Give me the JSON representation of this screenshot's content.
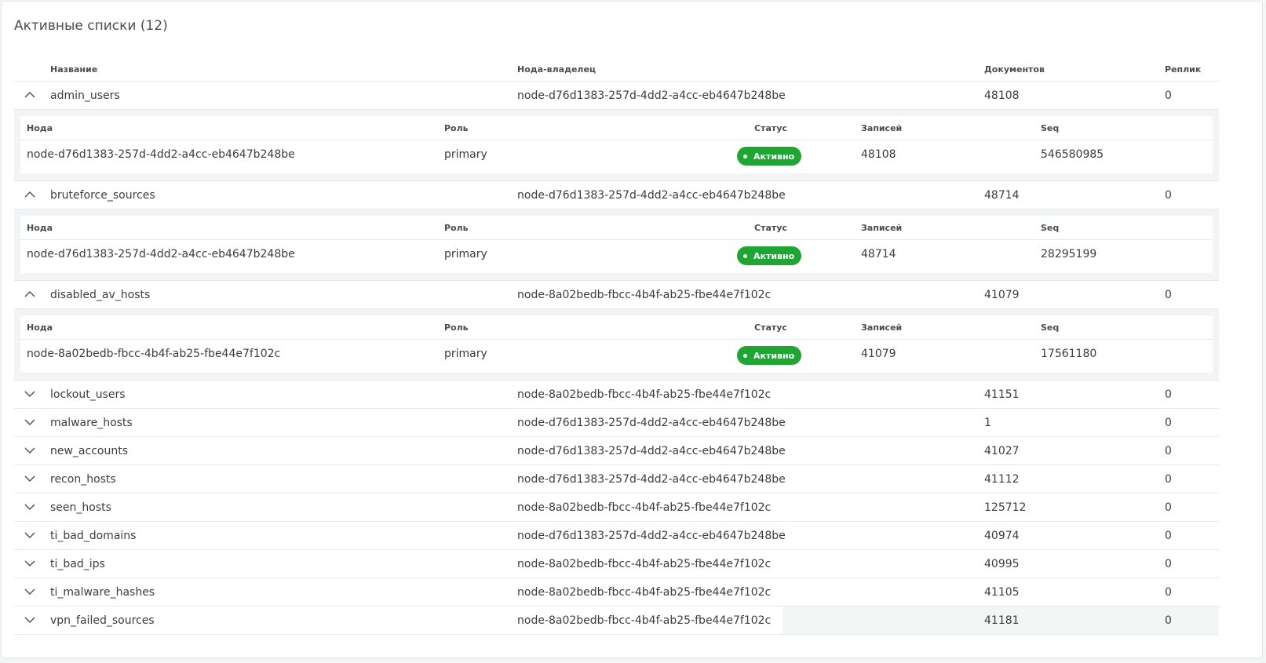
{
  "title": "Активные списки (12)",
  "columns": {
    "name": "Название",
    "owner": "Нода-владелец",
    "docs": "Документов",
    "replicas": "Реплик"
  },
  "sub_columns": {
    "node": "Нода",
    "role": "Роль",
    "status": "Статус",
    "records": "Записей",
    "seq": "Seq"
  },
  "colors": {
    "status_active": "#1ea532",
    "highlight": "#f2f6f4"
  },
  "rows": [
    {
      "name": "admin_users",
      "owner": "node-d76d1383-257d-4dd2-a4cc-eb4647b248be",
      "docs": "48108",
      "replicas": "0",
      "expanded": true,
      "detail": {
        "node": "node-d76d1383-257d-4dd2-a4cc-eb4647b248be",
        "role": "primary",
        "status": "Активно",
        "records": "48108",
        "seq": "546580985"
      }
    },
    {
      "name": "bruteforce_sources",
      "owner": "node-d76d1383-257d-4dd2-a4cc-eb4647b248be",
      "docs": "48714",
      "replicas": "0",
      "expanded": true,
      "detail": {
        "node": "node-d76d1383-257d-4dd2-a4cc-eb4647b248be",
        "role": "primary",
        "status": "Активно",
        "records": "48714",
        "seq": "28295199"
      }
    },
    {
      "name": "disabled_av_hosts",
      "owner": "node-8a02bedb-fbcc-4b4f-ab25-fbe44e7f102c",
      "docs": "41079",
      "replicas": "0",
      "expanded": true,
      "detail": {
        "node": "node-8a02bedb-fbcc-4b4f-ab25-fbe44e7f102c",
        "role": "primary",
        "status": "Активно",
        "records": "41079",
        "seq": "17561180"
      }
    },
    {
      "name": "lockout_users",
      "owner": "node-8a02bedb-fbcc-4b4f-ab25-fbe44e7f102c",
      "docs": "41151",
      "replicas": "0",
      "expanded": false
    },
    {
      "name": "malware_hosts",
      "owner": "node-d76d1383-257d-4dd2-a4cc-eb4647b248be",
      "docs": "1",
      "replicas": "0",
      "expanded": false
    },
    {
      "name": "new_accounts",
      "owner": "node-d76d1383-257d-4dd2-a4cc-eb4647b248be",
      "docs": "41027",
      "replicas": "0",
      "expanded": false
    },
    {
      "name": "recon_hosts",
      "owner": "node-d76d1383-257d-4dd2-a4cc-eb4647b248be",
      "docs": "41112",
      "replicas": "0",
      "expanded": false
    },
    {
      "name": "seen_hosts",
      "owner": "node-8a02bedb-fbcc-4b4f-ab25-fbe44e7f102c",
      "docs": "125712",
      "replicas": "0",
      "expanded": false
    },
    {
      "name": "ti_bad_domains",
      "owner": "node-d76d1383-257d-4dd2-a4cc-eb4647b248be",
      "docs": "40974",
      "replicas": "0",
      "expanded": false
    },
    {
      "name": "ti_bad_ips",
      "owner": "node-8a02bedb-fbcc-4b4f-ab25-fbe44e7f102c",
      "docs": "40995",
      "replicas": "0",
      "expanded": false
    },
    {
      "name": "ti_malware_hashes",
      "owner": "node-8a02bedb-fbcc-4b4f-ab25-fbe44e7f102c",
      "docs": "41105",
      "replicas": "0",
      "expanded": false
    },
    {
      "name": "vpn_failed_sources",
      "owner": "node-8a02bedb-fbcc-4b4f-ab25-fbe44e7f102c",
      "docs": "41181",
      "replicas": "0",
      "expanded": false,
      "hovered": true
    }
  ]
}
